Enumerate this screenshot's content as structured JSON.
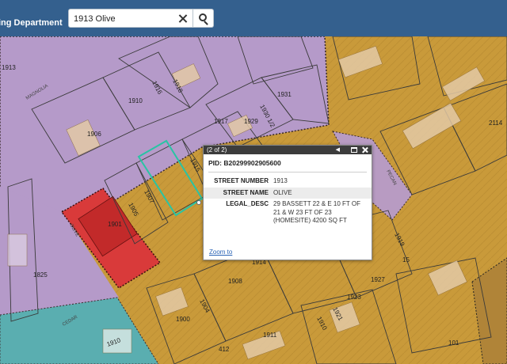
{
  "header": {
    "department": "ing Department",
    "search_value": "1913 Olive"
  },
  "popup": {
    "counter": "(2 of 2)",
    "pid": "PID: B20299902905600",
    "fields": [
      {
        "key": "STREET NUMBER",
        "value": "1913"
      },
      {
        "key": "STREET NAME",
        "value": "OLIVE"
      },
      {
        "key": "LEGAL_DESC",
        "value": "29 BASSETT 22 & E 10 FT OF 21 & W 23 FT OF 23 (HOMESITE) 4200 SQ FT"
      }
    ],
    "zoom_label": "Zoom to"
  },
  "map": {
    "parcel_labels": [
      "1913",
      "1918",
      "1910",
      "1916",
      "1906",
      "1931",
      "1930 1/2",
      "1929",
      "1917",
      "1915",
      "1907",
      "1905",
      "1901",
      "1914",
      "1908",
      "1904",
      "1900",
      "1825",
      "1910",
      "1911",
      "412",
      "1927",
      "1923",
      "1921",
      "1919",
      "15",
      "2114",
      "101",
      "1910"
    ],
    "street_labels": [
      "MAGNOLIA",
      "OLIVE",
      "PECAN",
      "CEDAR"
    ],
    "colors": {
      "zone_purple": "#b59ac9",
      "zone_gold": "#c99a3a",
      "zone_red": "#d93a3a",
      "zone_teal": "#5aaeb0",
      "highlight": "#29c4a4"
    }
  }
}
